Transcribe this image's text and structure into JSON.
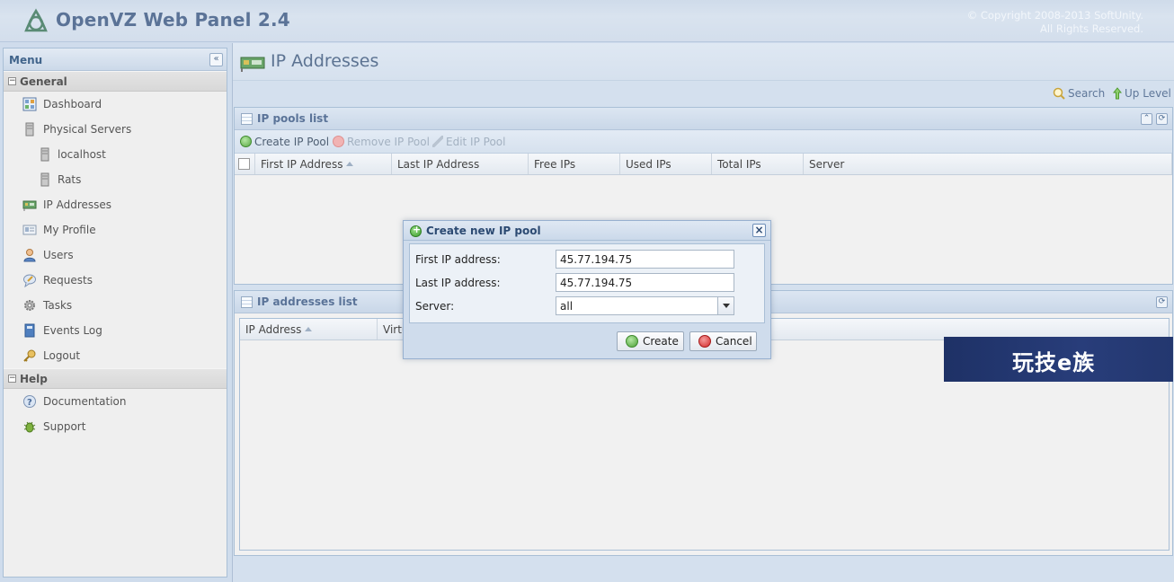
{
  "header": {
    "app_title": "OpenVZ Web Panel 2.4",
    "copyright_line1": "© Copyright 2008-2013 SoftUnity.",
    "copyright_line2": "All Rights Reserved."
  },
  "sidebar": {
    "title": "Menu",
    "collapse_symbol": "«",
    "sections": {
      "general": "General",
      "help": "Help"
    },
    "general_items": {
      "dashboard": "Dashboard",
      "physical_servers": "Physical Servers",
      "localhost": "localhost",
      "rats": "Rats",
      "ip_addresses": "IP Addresses",
      "my_profile": "My Profile",
      "users": "Users",
      "requests": "Requests",
      "tasks": "Tasks",
      "events_log": "Events Log",
      "logout": "Logout"
    },
    "help_items": {
      "documentation": "Documentation",
      "support": "Support"
    }
  },
  "main": {
    "page_title": "IP Addresses",
    "toolbar": {
      "search": "Search",
      "up_level": "Up Level"
    },
    "pools_panel": {
      "title": "IP pools list",
      "buttons": {
        "create": "Create IP Pool",
        "remove": "Remove IP Pool",
        "edit": "Edit IP Pool"
      },
      "columns": {
        "first_ip": "First IP Address",
        "last_ip": "Last IP Address",
        "free_ips": "Free IPs",
        "used_ips": "Used IPs",
        "total_ips": "Total IPs",
        "server": "Server"
      }
    },
    "addresses_panel": {
      "title": "IP addresses list",
      "columns": {
        "ip_address": "IP Address",
        "virtual": "Virtu"
      }
    }
  },
  "dialog": {
    "title": "Create new IP pool",
    "close_symbol": "×",
    "fields": {
      "first_ip_label": "First IP address:",
      "first_ip_value": "45.77.194.75",
      "last_ip_label": "Last IP address:",
      "last_ip_value": "45.77.194.75",
      "server_label": "Server:",
      "server_value": "all"
    },
    "buttons": {
      "create": "Create",
      "cancel": "Cancel"
    }
  },
  "watermark": {
    "text": "玩技e族"
  },
  "colors": {
    "brand_title": "#5b7397",
    "panel_title": "#5a7398",
    "dialog_title": "#2c4a72",
    "watermark_bg": "#23376f"
  }
}
